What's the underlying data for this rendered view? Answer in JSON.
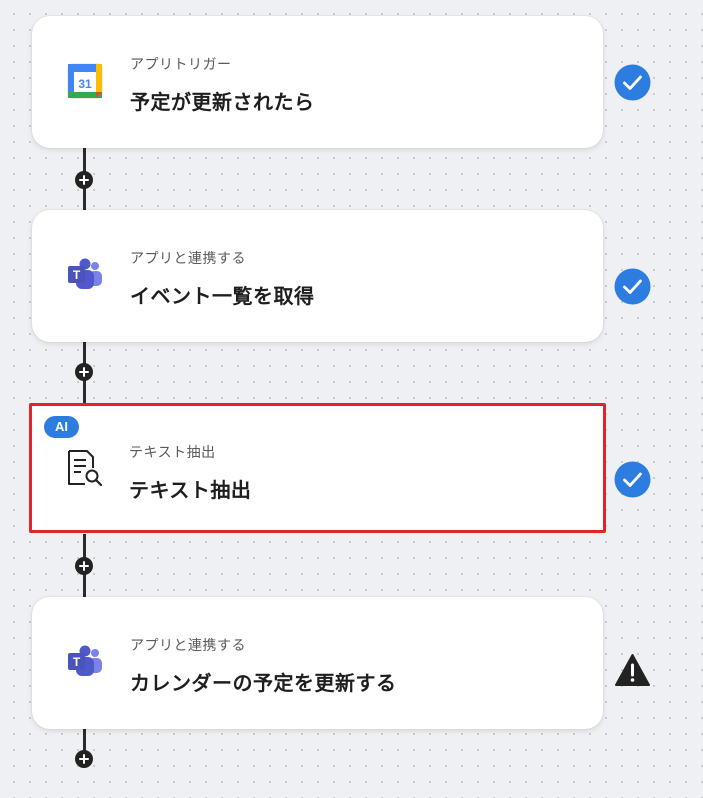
{
  "steps": [
    {
      "subtitle": "アプリトリガー",
      "title": "予定が更新されたら",
      "icon": "google-calendar-icon",
      "calendar_day": "31",
      "status": "complete"
    },
    {
      "subtitle": "アプリと連携する",
      "title": "イベント一覧を取得",
      "icon": "microsoft-teams-icon",
      "status": "complete"
    },
    {
      "subtitle": "テキスト抽出",
      "title": "テキスト抽出",
      "icon": "document-search-icon",
      "badge": "AI",
      "status": "complete",
      "highlighted": true
    },
    {
      "subtitle": "アプリと連携する",
      "title": "カレンダーの予定を更新する",
      "icon": "microsoft-teams-icon",
      "status": "warning"
    }
  ],
  "colors": {
    "accent": "#2d7de0",
    "highlight_border": "#e0242a",
    "connector": "#2a2a2a",
    "warning": "#222222"
  }
}
